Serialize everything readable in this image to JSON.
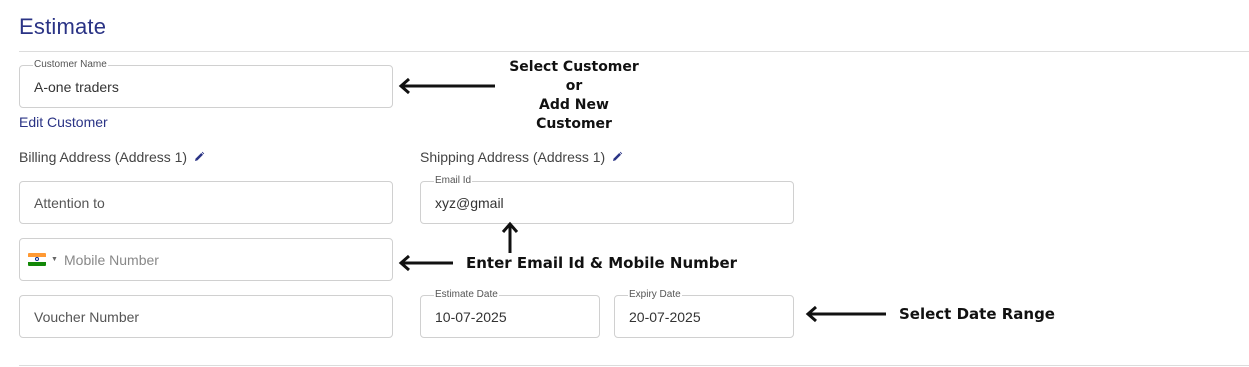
{
  "page": {
    "title": "Estimate"
  },
  "customer": {
    "label": "Customer Name",
    "value": "A-one traders",
    "edit_link": "Edit Customer"
  },
  "billing": {
    "label": "Billing Address (Address 1)",
    "attention_placeholder": "Attention to",
    "mobile_placeholder": "Mobile Number",
    "voucher_placeholder": "Voucher Number"
  },
  "shipping": {
    "label": "Shipping Address (Address 1)",
    "email_label": "Email Id",
    "email_value": "xyz@gmail"
  },
  "dates": {
    "estimate_label": "Estimate Date",
    "estimate_value": "10-07-2025",
    "expiry_label": "Expiry Date",
    "expiry_value": "20-07-2025"
  },
  "annotations": {
    "customer_line1": "Select Customer",
    "customer_line2": "or",
    "customer_line3": "Add New Customer",
    "contact": "Enter Email Id & Mobile Number",
    "date_range": "Select Date Range"
  },
  "icons": {
    "edit": "pencil-icon",
    "country_flag": "india-flag-icon",
    "dropdown": "caret-down-icon"
  },
  "colors": {
    "accent": "#2a3385",
    "border": "#d0d0d0"
  }
}
